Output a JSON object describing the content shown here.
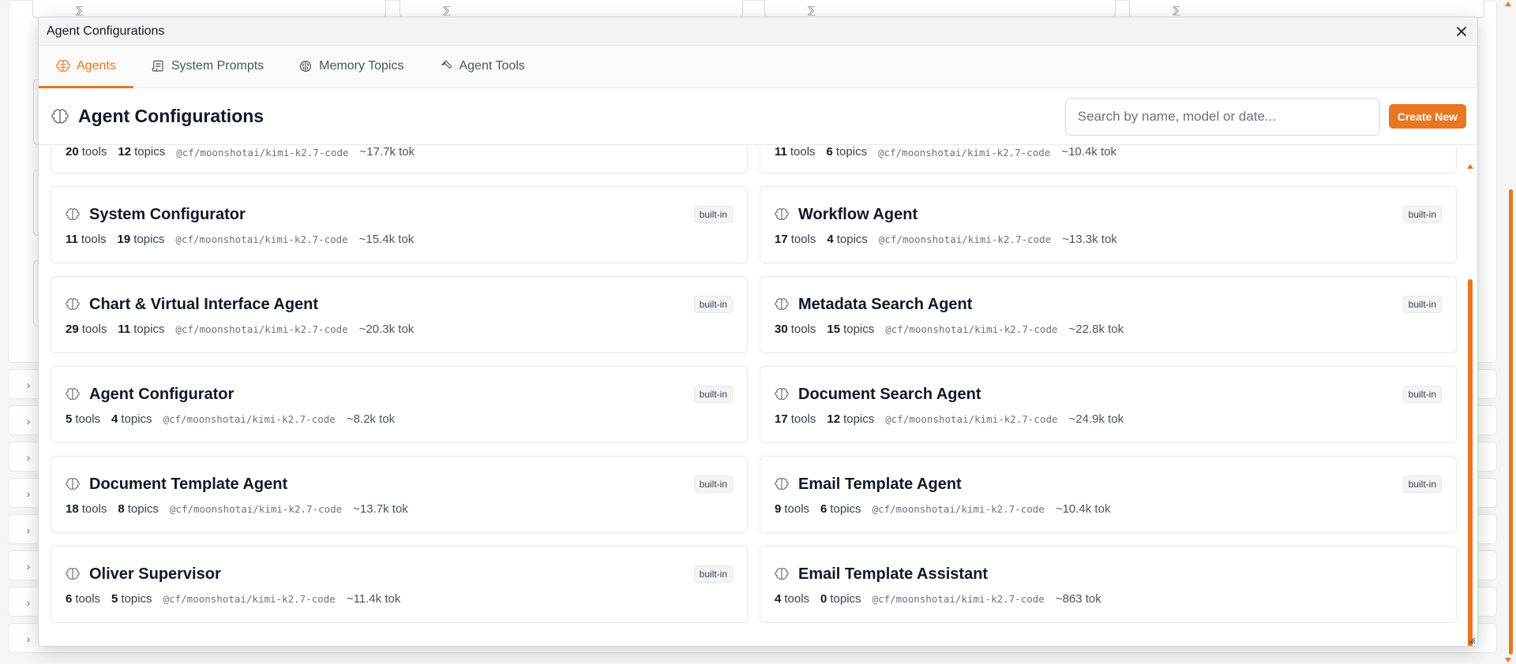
{
  "background": {
    "collapsed_rows": 8
  },
  "dialog": {
    "window_title": "Agent Configurations",
    "close_label": "×",
    "tabs": [
      {
        "label": "Agents",
        "icon": "brain-icon",
        "active": true
      },
      {
        "label": "System Prompts",
        "icon": "scroll-icon",
        "active": false
      },
      {
        "label": "Memory Topics",
        "icon": "brain-outline-icon",
        "active": false
      },
      {
        "label": "Agent Tools",
        "icon": "wrench-icon",
        "active": false
      }
    ],
    "header": {
      "title": "Agent Configurations",
      "search_placeholder": "Search by name, model or date...",
      "create_label": "Create New"
    },
    "cards": [
      {
        "name": "",
        "badge": "",
        "tools": "20",
        "topics": "12",
        "model": "@cf/moonshotai/kimi-k2.7-code",
        "tokens": "~17.7k tok",
        "cut": true
      },
      {
        "name": "",
        "badge": "",
        "tools": "11",
        "topics": "6",
        "model": "@cf/moonshotai/kimi-k2.7-code",
        "tokens": "~10.4k tok",
        "cut": true
      },
      {
        "name": "System Configurator",
        "badge": "built-in",
        "tools": "11",
        "topics": "19",
        "model": "@cf/moonshotai/kimi-k2.7-code",
        "tokens": "~15.4k tok"
      },
      {
        "name": "Workflow Agent",
        "badge": "built-in",
        "tools": "17",
        "topics": "4",
        "model": "@cf/moonshotai/kimi-k2.7-code",
        "tokens": "~13.3k tok"
      },
      {
        "name": "Chart & Virtual Interface Agent",
        "badge": "built-in",
        "tools": "29",
        "topics": "11",
        "model": "@cf/moonshotai/kimi-k2.7-code",
        "tokens": "~20.3k tok"
      },
      {
        "name": "Metadata Search Agent",
        "badge": "built-in",
        "tools": "30",
        "topics": "15",
        "model": "@cf/moonshotai/kimi-k2.7-code",
        "tokens": "~22.8k tok"
      },
      {
        "name": "Agent Configurator",
        "badge": "built-in",
        "tools": "5",
        "topics": "4",
        "model": "@cf/moonshotai/kimi-k2.7-code",
        "tokens": "~8.2k tok"
      },
      {
        "name": "Document Search Agent",
        "badge": "built-in",
        "tools": "17",
        "topics": "12",
        "model": "@cf/moonshotai/kimi-k2.7-code",
        "tokens": "~24.9k tok"
      },
      {
        "name": "Document Template Agent",
        "badge": "built-in",
        "tools": "18",
        "topics": "8",
        "model": "@cf/moonshotai/kimi-k2.7-code",
        "tokens": "~13.7k tok"
      },
      {
        "name": "Email Template Agent",
        "badge": "built-in",
        "tools": "9",
        "topics": "6",
        "model": "@cf/moonshotai/kimi-k2.7-code",
        "tokens": "~10.4k tok"
      },
      {
        "name": "Oliver Supervisor",
        "badge": "built-in",
        "tools": "6",
        "topics": "5",
        "model": "@cf/moonshotai/kimi-k2.7-code",
        "tokens": "~11.4k tok"
      },
      {
        "name": "Email Template Assistant",
        "badge": "",
        "tools": "4",
        "topics": "0",
        "model": "@cf/moonshotai/kimi-k2.7-code",
        "tokens": "~863 tok"
      }
    ],
    "labels": {
      "tools": "tools",
      "topics": "topics"
    }
  },
  "colors": {
    "accent": "#e87722",
    "text": "#111827",
    "muted": "#6b7280"
  }
}
